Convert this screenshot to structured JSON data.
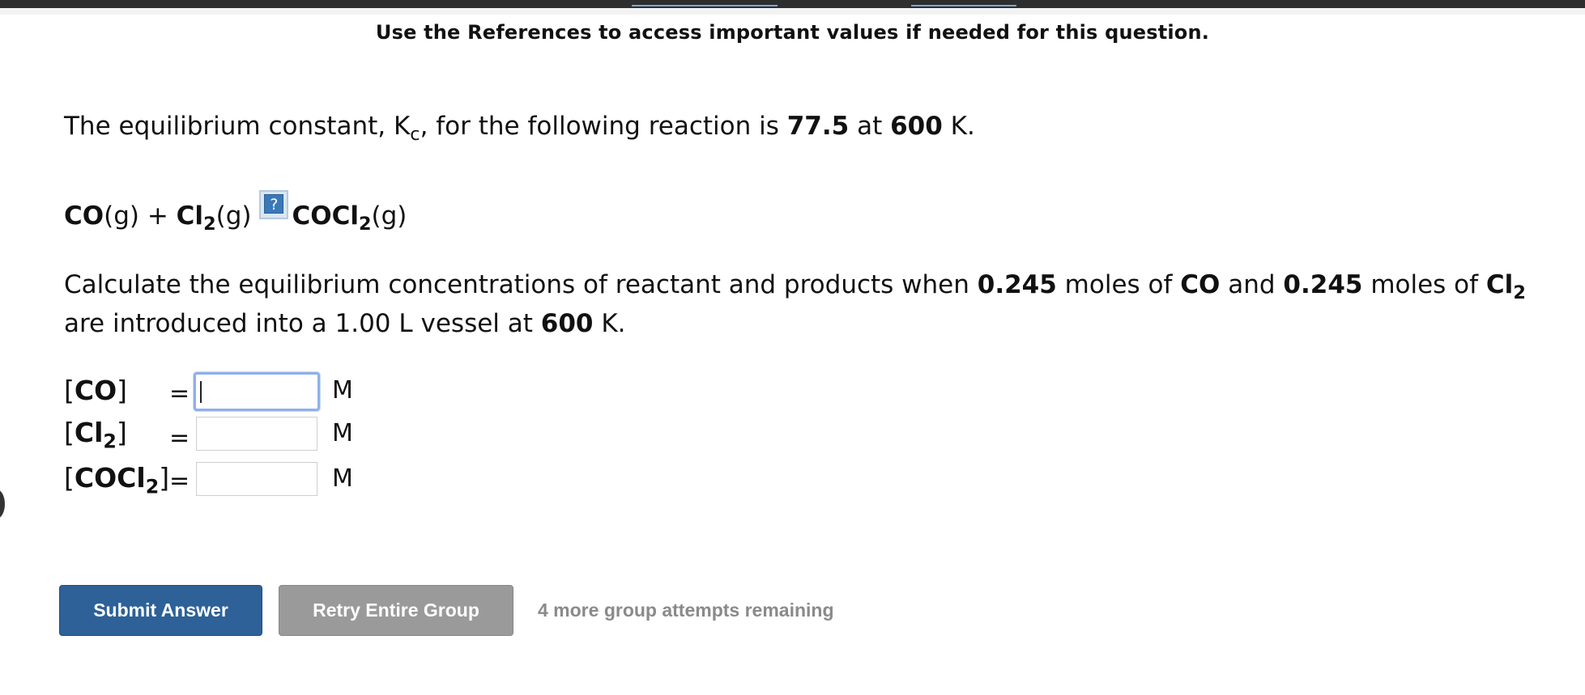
{
  "header": {
    "references_note": "Use the References to access important values if needed for this question."
  },
  "question": {
    "intro_prefix": "The equilibrium constant, K",
    "intro_k_sub": "c",
    "intro_mid": ", for the following reaction is ",
    "k_value": "77.5",
    "intro_at": " at ",
    "temperature": "600",
    "intro_unit": " K.",
    "reaction": {
      "reactant1": "CO",
      "reactant1_state": "(g)",
      "plus": " + ",
      "reactant2": "Cl",
      "reactant2_sub": "2",
      "reactant2_state": "(g)",
      "arrow_help": "?",
      "product": "COCl",
      "product_sub": "2",
      "product_state": "(g)"
    },
    "task": {
      "t1": "Calculate the equilibrium concentrations of reactant and products when ",
      "moles_co": "0.245",
      "t2": " moles of ",
      "co": "CO",
      "t3": " and ",
      "moles_cl2": "0.245",
      "t4": " moles of ",
      "cl": "Cl",
      "cl_sub": "2",
      "t5": " are introduced into a 1.00 L vessel at ",
      "temp": "600",
      "t6": " K."
    }
  },
  "answers": [
    {
      "label_open": "[",
      "species": "CO",
      "sub": "",
      "label_close": "]",
      "eq": "=",
      "value": "",
      "unit": "M"
    },
    {
      "label_open": "[",
      "species": "Cl",
      "sub": "2",
      "label_close": "]",
      "eq": "=",
      "value": "",
      "unit": "M"
    },
    {
      "label_open": "[",
      "species": "COCl",
      "sub": "2",
      "label_close": "]",
      "eq": "=",
      "value": "",
      "unit": "M"
    }
  ],
  "actions": {
    "submit_label": "Submit Answer",
    "retry_label": "Retry Entire Group",
    "attempts_text": "4 more group attempts remaining"
  },
  "colors": {
    "submit_bg": "#2d6197",
    "retry_bg": "#9a9a9a",
    "focus_border": "#8fb0ea"
  }
}
